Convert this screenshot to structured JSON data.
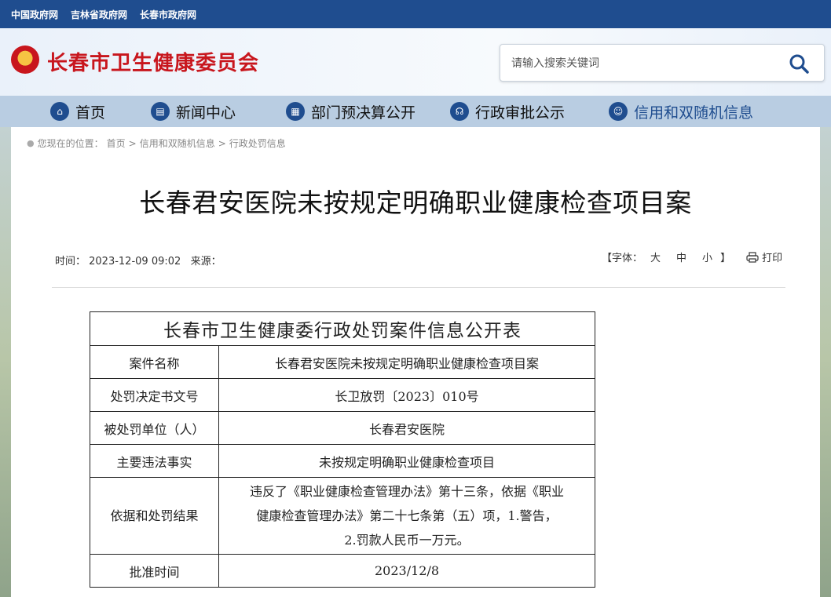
{
  "topbar": {
    "links": [
      "中国政府网",
      "吉林省政府网",
      "长春市政府网"
    ]
  },
  "header": {
    "site_title": "长春市卫生健康委员会",
    "search_placeholder": "请输入搜索关键词"
  },
  "nav": {
    "items": [
      "首页",
      "新闻中心",
      "部门预决算公开",
      "行政审批公示",
      "信用和双随机信息"
    ]
  },
  "breadcrumb": {
    "prefix": "您现在的位置：",
    "items": [
      "首页",
      "信用和双随机信息",
      "行政处罚信息"
    ],
    "separator": ">"
  },
  "article": {
    "title": "长春君安医院未按规定明确职业健康检查项目案",
    "meta": "时间： 2023-12-09 09:02   来源：",
    "font_label": "【字体：",
    "font_sizes": [
      "大",
      "中",
      "小"
    ],
    "font_close": "】",
    "print_label": "打印"
  },
  "table": {
    "caption": "长春市卫生健康委行政处罚案件信息公开表",
    "rows": [
      {
        "label": "案件名称",
        "value": "长春君安医院未按规定明确职业健康检查项目案"
      },
      {
        "label": "处罚决定书文号",
        "value": "长卫放罚〔2023〕010号"
      },
      {
        "label": "被处罚单位（人）",
        "value": "长春君安医院"
      },
      {
        "label": "主要违法事实",
        "value": "未按规定明确职业健康检查项目"
      },
      {
        "label": "依据和处罚结果",
        "value_lines": [
          "违反了《职业健康检查管理办法》第十三条，依据《职业",
          "健康检查管理办法》第二十七条第（五）项，1.警告，",
          "2.罚款人民币一万元。"
        ]
      },
      {
        "label": "批准时间",
        "value": "2023/12/8"
      }
    ]
  }
}
